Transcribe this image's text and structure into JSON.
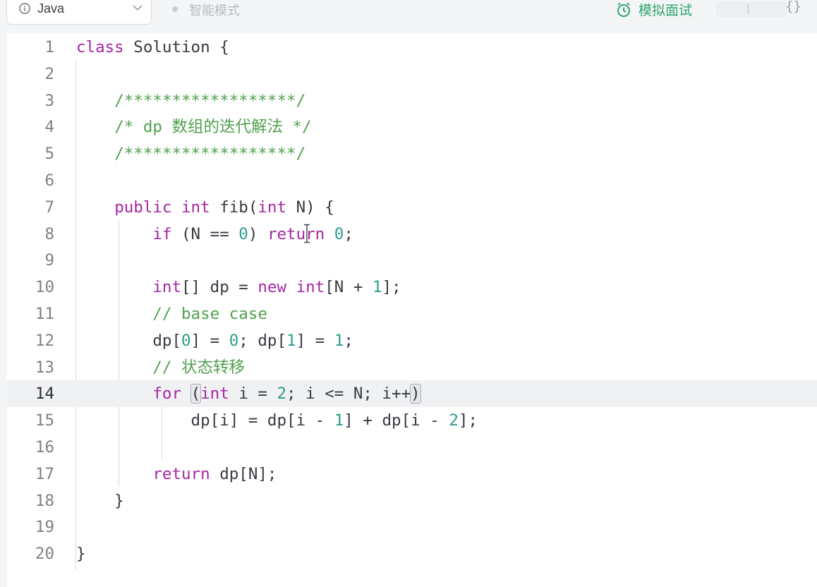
{
  "toolbar": {
    "language": "Java",
    "mode_label": "智能模式",
    "interview_label": "模拟面试",
    "format_icon": "{}"
  },
  "colors": {
    "keyword": "#a626a4",
    "comment": "#50a14f",
    "number": "#2c9e8e",
    "text": "#383a42",
    "accent": "#2fa66e"
  },
  "editor": {
    "current_line": 14,
    "lines": [
      {
        "num": "1",
        "tokens": [
          {
            "t": "kw",
            "v": "class"
          },
          {
            "t": "tx",
            "v": " Solution {"
          }
        ]
      },
      {
        "num": "2",
        "tokens": []
      },
      {
        "num": "3",
        "tokens": [
          {
            "t": "tx",
            "v": "    "
          },
          {
            "t": "cm",
            "v": "/******************/"
          }
        ]
      },
      {
        "num": "4",
        "tokens": [
          {
            "t": "tx",
            "v": "    "
          },
          {
            "t": "cm",
            "v": "/* dp 数组的迭代解法 */"
          }
        ]
      },
      {
        "num": "5",
        "tokens": [
          {
            "t": "tx",
            "v": "    "
          },
          {
            "t": "cm",
            "v": "/******************/"
          }
        ]
      },
      {
        "num": "6",
        "tokens": []
      },
      {
        "num": "7",
        "tokens": [
          {
            "t": "tx",
            "v": "    "
          },
          {
            "t": "kw",
            "v": "public"
          },
          {
            "t": "tx",
            "v": " "
          },
          {
            "t": "kw",
            "v": "int"
          },
          {
            "t": "tx",
            "v": " fib("
          },
          {
            "t": "kw",
            "v": "int"
          },
          {
            "t": "tx",
            "v": " N) {"
          }
        ]
      },
      {
        "num": "8",
        "tokens": [
          {
            "t": "tx",
            "v": "        "
          },
          {
            "t": "kw",
            "v": "if"
          },
          {
            "t": "tx",
            "v": " (N == "
          },
          {
            "t": "nm",
            "v": "0"
          },
          {
            "t": "tx",
            "v": ") "
          },
          {
            "t": "kw",
            "v": "return"
          },
          {
            "t": "tx",
            "v": " "
          },
          {
            "t": "nm",
            "v": "0"
          },
          {
            "t": "tx",
            "v": ";"
          }
        ]
      },
      {
        "num": "9",
        "tokens": []
      },
      {
        "num": "10",
        "tokens": [
          {
            "t": "tx",
            "v": "        "
          },
          {
            "t": "kw",
            "v": "int"
          },
          {
            "t": "tx",
            "v": "[] dp = "
          },
          {
            "t": "kw",
            "v": "new"
          },
          {
            "t": "tx",
            "v": " "
          },
          {
            "t": "kw",
            "v": "int"
          },
          {
            "t": "tx",
            "v": "[N + "
          },
          {
            "t": "nm",
            "v": "1"
          },
          {
            "t": "tx",
            "v": "];"
          }
        ]
      },
      {
        "num": "11",
        "tokens": [
          {
            "t": "tx",
            "v": "        "
          },
          {
            "t": "cm",
            "v": "// base case"
          }
        ]
      },
      {
        "num": "12",
        "tokens": [
          {
            "t": "tx",
            "v": "        dp["
          },
          {
            "t": "nm",
            "v": "0"
          },
          {
            "t": "tx",
            "v": "] = "
          },
          {
            "t": "nm",
            "v": "0"
          },
          {
            "t": "tx",
            "v": "; dp["
          },
          {
            "t": "nm",
            "v": "1"
          },
          {
            "t": "tx",
            "v": "] = "
          },
          {
            "t": "nm",
            "v": "1"
          },
          {
            "t": "tx",
            "v": ";"
          }
        ]
      },
      {
        "num": "13",
        "tokens": [
          {
            "t": "tx",
            "v": "        "
          },
          {
            "t": "cm",
            "v": "// 状态转移"
          }
        ]
      },
      {
        "num": "14",
        "tokens": [
          {
            "t": "tx",
            "v": "        "
          },
          {
            "t": "kw",
            "v": "for"
          },
          {
            "t": "tx",
            "v": " "
          },
          {
            "t": "hl",
            "v": "("
          },
          {
            "t": "kw",
            "v": "int"
          },
          {
            "t": "tx",
            "v": " i = "
          },
          {
            "t": "nm",
            "v": "2"
          },
          {
            "t": "tx",
            "v": "; i <= N; i++"
          },
          {
            "t": "hl",
            "v": ")"
          }
        ]
      },
      {
        "num": "15",
        "tokens": [
          {
            "t": "tx",
            "v": "            dp[i] = dp[i - "
          },
          {
            "t": "nm",
            "v": "1"
          },
          {
            "t": "tx",
            "v": "] + dp[i - "
          },
          {
            "t": "nm",
            "v": "2"
          },
          {
            "t": "tx",
            "v": "];"
          }
        ]
      },
      {
        "num": "16",
        "tokens": []
      },
      {
        "num": "17",
        "tokens": [
          {
            "t": "tx",
            "v": "        "
          },
          {
            "t": "kw",
            "v": "return"
          },
          {
            "t": "tx",
            "v": " dp[N];"
          }
        ]
      },
      {
        "num": "18",
        "tokens": [
          {
            "t": "tx",
            "v": "    }"
          }
        ]
      },
      {
        "num": "19",
        "tokens": []
      },
      {
        "num": "20",
        "tokens": [
          {
            "t": "tx",
            "v": "}"
          }
        ]
      }
    ]
  }
}
